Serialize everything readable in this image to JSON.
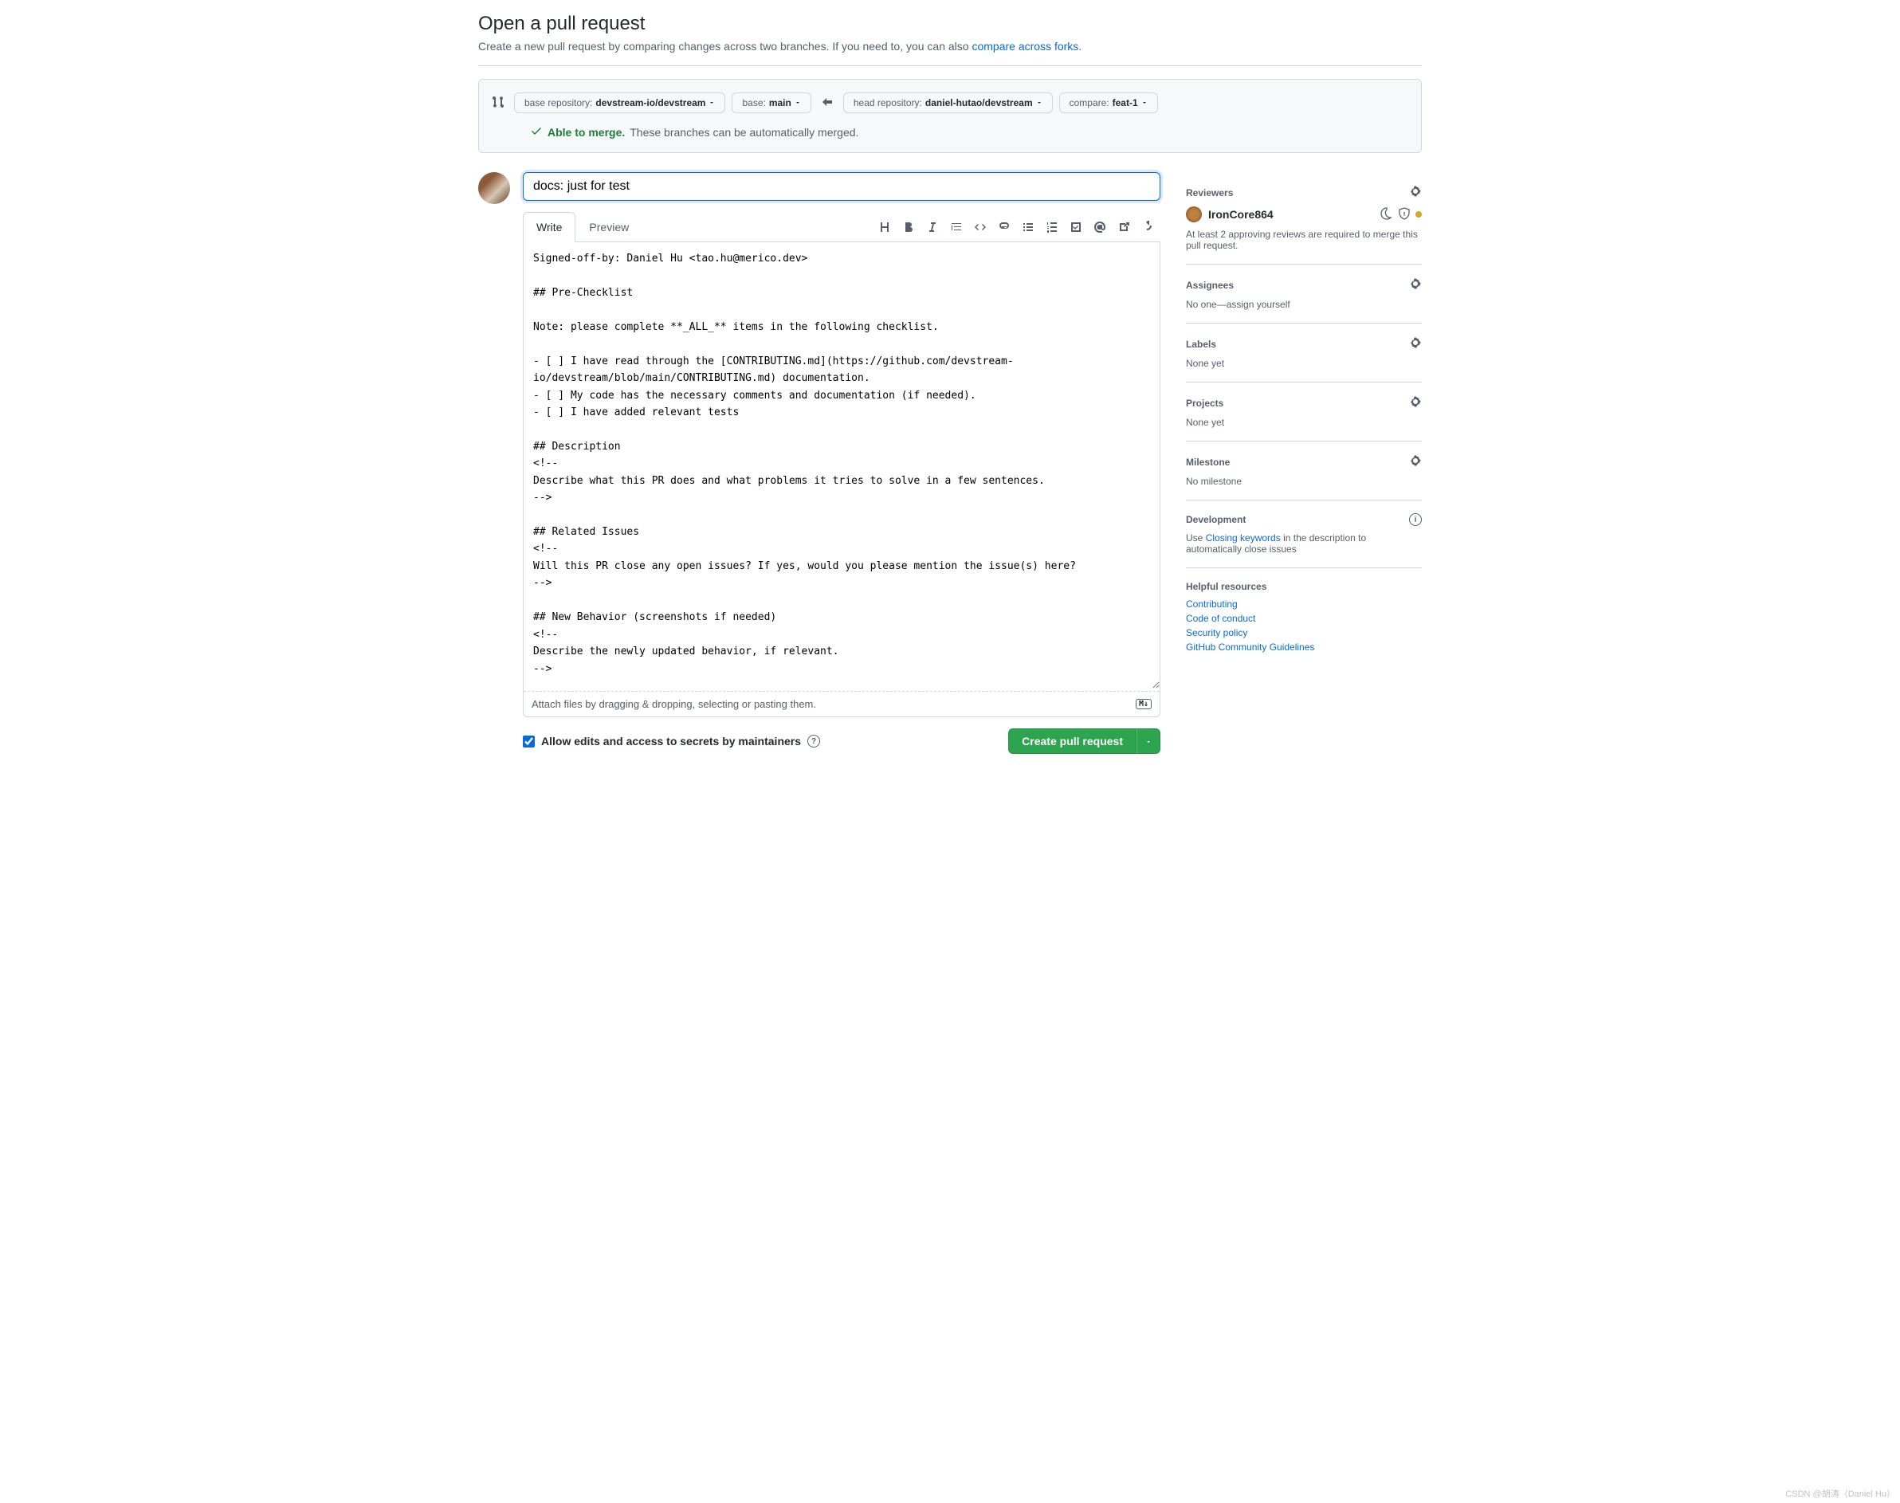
{
  "header": {
    "title": "Open a pull request",
    "subtitle_prefix": "Create a new pull request by comparing changes across two branches. If you need to, you can also ",
    "subtitle_link": "compare across forks",
    "subtitle_suffix": "."
  },
  "compare": {
    "base_repo_label": "base repository: ",
    "base_repo_value": "devstream-io/devstream",
    "base_label": "base: ",
    "base_value": "main",
    "head_repo_label": "head repository: ",
    "head_repo_value": "daniel-hutao/devstream",
    "compare_label": "compare: ",
    "compare_value": "feat-1"
  },
  "merge": {
    "status": "Able to merge.",
    "note": "These branches can be automatically merged."
  },
  "form": {
    "title_value": "docs: just for test",
    "tabs": {
      "write": "Write",
      "preview": "Preview"
    },
    "body": "Signed-off-by: Daniel Hu <tao.hu@merico.dev>\n\n## Pre-Checklist\n\nNote: please complete **_ALL_** items in the following checklist.\n\n- [ ] I have read through the [CONTRIBUTING.md](https://github.com/devstream-io/devstream/blob/main/CONTRIBUTING.md) documentation.\n- [ ] My code has the necessary comments and documentation (if needed).\n- [ ] I have added relevant tests\n\n## Description\n<!--\nDescribe what this PR does and what problems it tries to solve in a few sentences.\n-->\n\n## Related Issues\n<!--\nWill this PR close any open issues? If yes, would you please mention the issue(s) here?\n-->\n\n## New Behavior (screenshots if needed)\n<!--\nDescribe the newly updated behavior, if relevant.\n-->",
    "attach_hint": "Attach files by dragging & dropping, selecting or pasting them.",
    "allow_edits": "Allow edits and access to secrets by maintainers",
    "create_button": "Create pull request"
  },
  "sidebar": {
    "reviewers": {
      "title": "Reviewers",
      "name": "IronCore864",
      "note": "At least 2 approving reviews are required to merge this pull request."
    },
    "assignees": {
      "title": "Assignees",
      "text": "No one—assign yourself"
    },
    "labels": {
      "title": "Labels",
      "text": "None yet"
    },
    "projects": {
      "title": "Projects",
      "text": "None yet"
    },
    "milestone": {
      "title": "Milestone",
      "text": "No milestone"
    },
    "development": {
      "title": "Development",
      "prefix": "Use ",
      "link": "Closing keywords",
      "suffix": " in the description to automatically close issues"
    },
    "resources": {
      "title": "Helpful resources",
      "links": [
        "Contributing",
        "Code of conduct",
        "Security policy",
        "GitHub Community Guidelines"
      ]
    }
  },
  "watermark": "CSDN @胡涛（Daniel Hu）"
}
